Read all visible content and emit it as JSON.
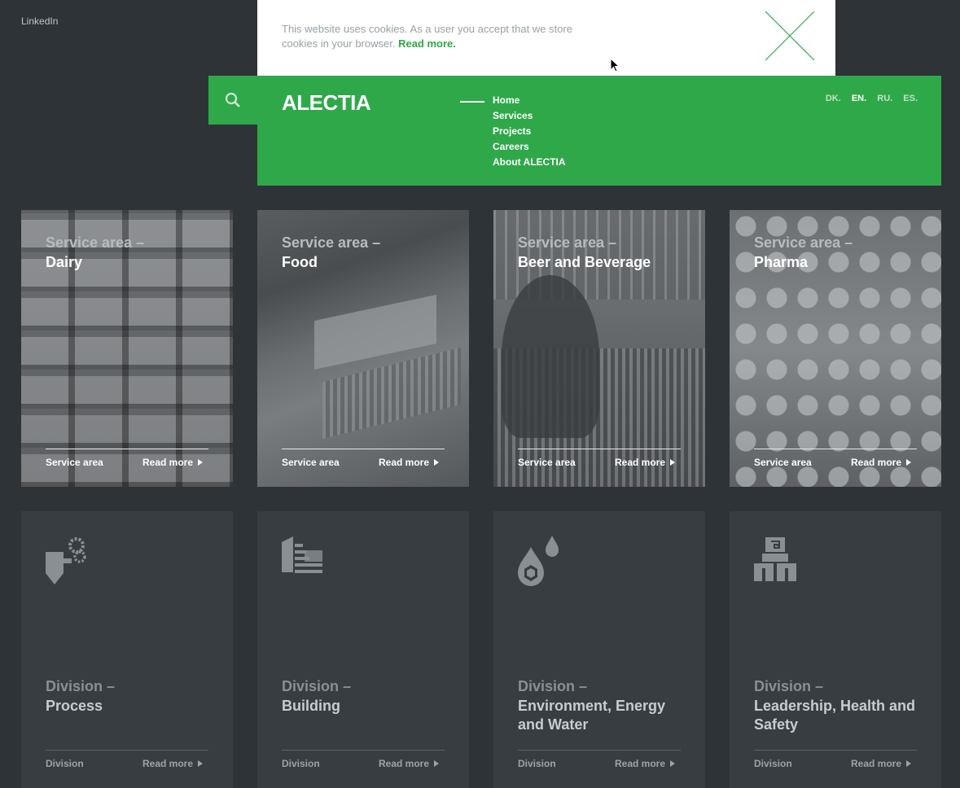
{
  "top": {
    "linkedin": "LinkedIn"
  },
  "cookie": {
    "text": "This website uses cookies. As a user you accept that we store cookies in your browser.",
    "link": "Read more."
  },
  "header": {
    "logo": "ALECTIA",
    "nav": [
      "Home",
      "Services",
      "Projects",
      "Careers",
      "About ALECTIA"
    ],
    "langs": [
      {
        "label": "DK.",
        "active": false
      },
      {
        "label": "EN.",
        "active": true
      },
      {
        "label": "RU.",
        "active": false
      },
      {
        "label": "ES.",
        "active": false
      }
    ]
  },
  "service_areas": [
    {
      "pre": "Service area –",
      "title": "Dairy",
      "foot": "Service area",
      "more": "Read more"
    },
    {
      "pre": "Service area –",
      "title": "Food",
      "foot": "Service area",
      "more": "Read more"
    },
    {
      "pre": "Service area –",
      "title": "Beer and Beverage",
      "foot": "Service area",
      "more": "Read more"
    },
    {
      "pre": "Service area –",
      "title": "Pharma",
      "foot": "Service area",
      "more": "Read more"
    }
  ],
  "divisions": [
    {
      "pre": "Division –",
      "title": "Process",
      "foot": "Division",
      "more": "Read more",
      "icon": "process-gears-icon"
    },
    {
      "pre": "Division –",
      "title": "Building",
      "foot": "Division",
      "more": "Read more",
      "icon": "building-icon"
    },
    {
      "pre": "Division –",
      "title": "Environment, Energy and Water",
      "foot": "Division",
      "more": "Read more",
      "icon": "water-drop-icon"
    },
    {
      "pre": "Division –",
      "title": "Leadership, Health and Safety",
      "foot": "Division",
      "more": "Read more",
      "icon": "people-icon"
    }
  ],
  "colors": {
    "brand_green": "#2fa84a",
    "background": "#2e3337",
    "card": "#383d42"
  }
}
